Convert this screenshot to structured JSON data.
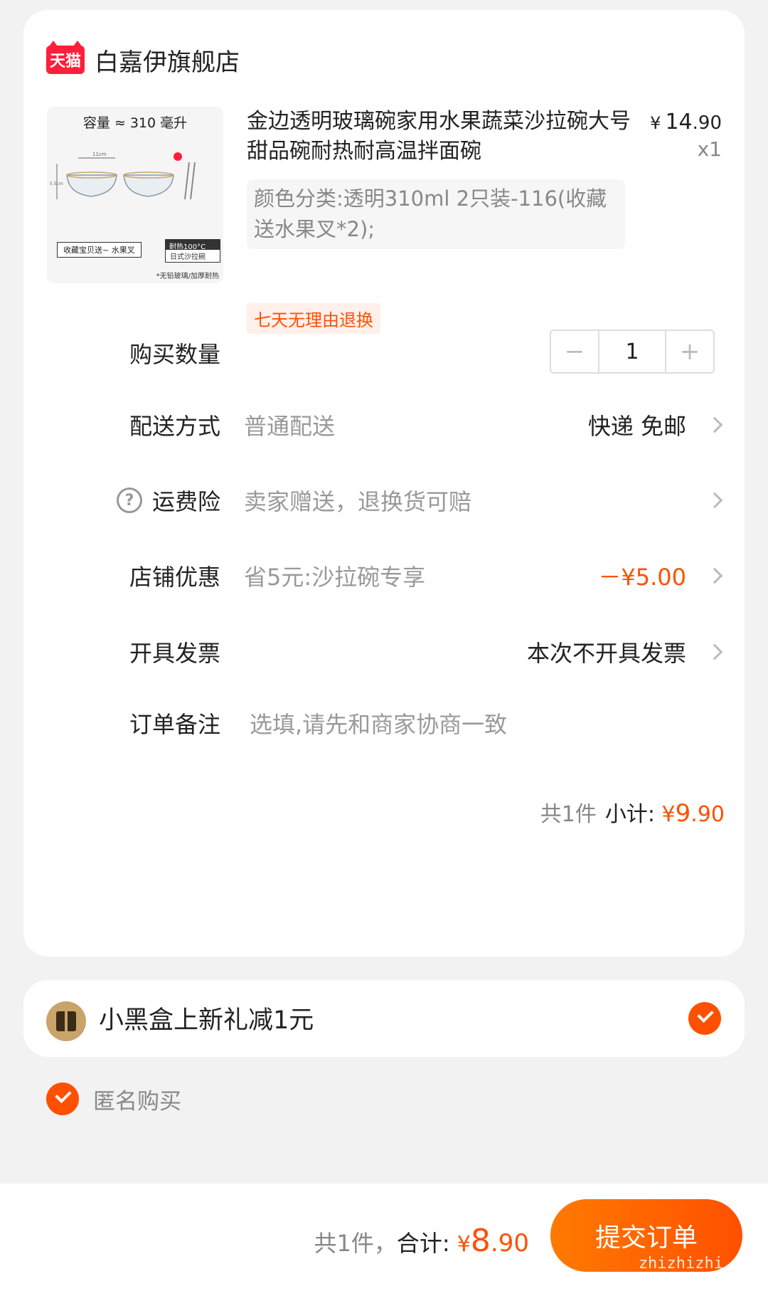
{
  "store": {
    "logo_text": "天猫",
    "name": "白嘉伊旗舰店"
  },
  "product": {
    "image_caption": "容量 ≈ 310 毫升",
    "image_tag1": "收藏宝贝送~ 水果叉",
    "image_tag2": "耐热100°C",
    "image_tag3": "日式沙拉碗",
    "image_note": "*无铅玻璃/加厚耐热",
    "title": "金边透明玻璃碗家用水果蔬菜沙拉碗大号甜品碗耐热耐高温拌面碗",
    "price_symbol": "¥",
    "price_int": "14",
    "price_dec": ".90",
    "quantity_label": "x1",
    "sku": "颜色分类:透明310ml 2只装-116(收藏送水果叉*2);",
    "return_policy": "七天无理由退换"
  },
  "quantity": {
    "label": "购买数量",
    "minus": "−",
    "value": "1",
    "plus": "+"
  },
  "delivery": {
    "label": "配送方式",
    "desc": "普通配送",
    "value": "快递 免邮"
  },
  "insurance": {
    "label": "运费险",
    "icon": "?",
    "desc": "卖家赠送，退换货可赔"
  },
  "coupon": {
    "label": "店铺优惠",
    "desc": "省5元:沙拉碗专享",
    "value": "－¥5.00"
  },
  "invoice": {
    "label": "开具发票",
    "value": "本次不开具发票"
  },
  "note": {
    "label": "订单备注",
    "placeholder": "选填,请先和商家协商一致"
  },
  "subtotal": {
    "count": "共1件",
    "label": "小计:",
    "symbol": "¥",
    "int": "9",
    "dec": ".90"
  },
  "gift": {
    "text": "小黑盒上新礼减1元",
    "checked": true
  },
  "anonymous": {
    "text": "匿名购买",
    "checked": true
  },
  "footer": {
    "count": "共1件，",
    "label": "合计:",
    "symbol": "¥",
    "int": "8",
    "dec": ".90",
    "submit": "提交订单",
    "watermark": "zhizhizhi.com"
  },
  "colors": {
    "accent": "#ff5000",
    "tmall": "#ff1f3b"
  }
}
